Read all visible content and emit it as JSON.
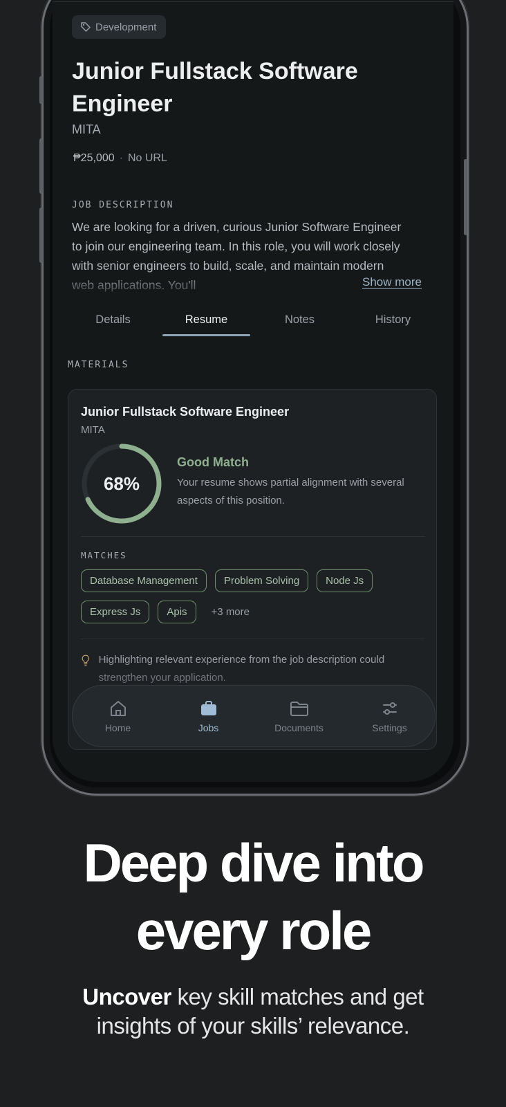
{
  "job": {
    "tag": "Development",
    "tag_icon": "tag-icon",
    "title": "Junior Fullstack Software Engineer",
    "company": "MITA",
    "salary": "₱25,000",
    "separator": "·",
    "url": "No URL"
  },
  "description": {
    "label": "JOB DESCRIPTION",
    "text": "We are looking for a driven, curious Junior Software Engineer to join our engineering team. In this role, you will work closely with senior engineers to build, scale, and maintain modern web applications. You'll",
    "show_more": "Show more"
  },
  "tabs": [
    {
      "label": "Details"
    },
    {
      "label": "Resume"
    },
    {
      "label": "Notes"
    },
    {
      "label": "History"
    }
  ],
  "active_tab": "Resume",
  "materials": {
    "label": "MATERIALS",
    "card": {
      "title": "Junior Fullstack Software Engineer",
      "company": "MITA",
      "score_text": "68%",
      "score": 0.68,
      "match_title": "Good Match",
      "match_text": "Your resume shows partial alignment with several aspects of this position.",
      "matches_label": "MATCHES",
      "chips": [
        "Database Management",
        "Problem Solving",
        "Node Js",
        "Express Js",
        "Apis"
      ],
      "more": "+3 more",
      "tip_icon": "lightbulb-icon",
      "tip": "Highlighting relevant experience from the job description could strengthen your application."
    }
  },
  "nav": [
    {
      "label": "Home",
      "icon": "home-icon"
    },
    {
      "label": "Jobs",
      "icon": "briefcase-icon"
    },
    {
      "label": "Documents",
      "icon": "folder-icon"
    },
    {
      "label": "Settings",
      "icon": "sliders-icon"
    }
  ],
  "marketing": {
    "headline_line1": "Deep dive into",
    "headline_line2": "every role",
    "sub_bold": "Uncover",
    "sub_rest": " key skill matches and get insights of your skills’ relevance."
  },
  "colors": {
    "accent_green": "#8fb08f",
    "accent_blue": "#9fbbd6",
    "background": "#1e1f21"
  }
}
